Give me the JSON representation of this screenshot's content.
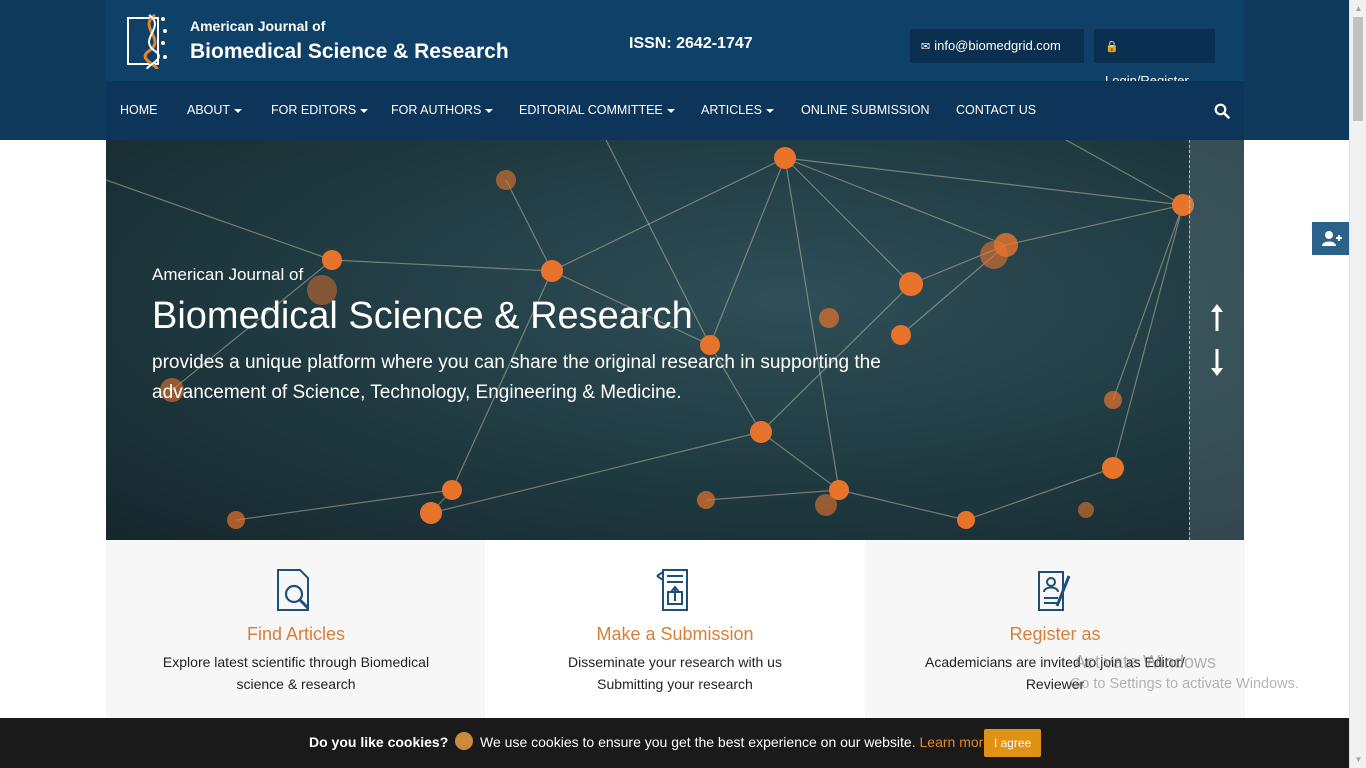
{
  "header": {
    "logo_small": "American Journal of",
    "logo_big": "Biomedical Science & Research",
    "issn": "ISSN: 2642-1747",
    "email": "info@biomedgrid.com",
    "login": "Login/Register"
  },
  "nav": {
    "items": [
      {
        "label": "HOME",
        "caret": false
      },
      {
        "label": "ABOUT",
        "caret": true
      },
      {
        "label": "FOR EDITORS",
        "caret": true
      },
      {
        "label": "FOR AUTHORS",
        "caret": true
      },
      {
        "label": "EDITORIAL COMMITTEE",
        "caret": true
      },
      {
        "label": "ARTICLES",
        "caret": true
      },
      {
        "label": "ONLINE SUBMISSION",
        "caret": false
      },
      {
        "label": "CONTACT US",
        "caret": false
      }
    ]
  },
  "hero": {
    "small": "American Journal of",
    "title": "Biomedical Science & Research",
    "desc": "provides a unique platform where you can share the original research in supporting the advancement of Science, Technology, Engineering & Medicine."
  },
  "features": [
    {
      "title": "Find Articles",
      "desc": "Explore latest scientific through Biomedical science & research",
      "icon": "search-document-icon"
    },
    {
      "title": "Make a Submission",
      "desc": "Disseminate your research with us Submitting your research",
      "icon": "upload-document-icon"
    },
    {
      "title": "Register as",
      "desc": "Academicians are invited to join as Editor/ Reviewer",
      "icon": "register-form-icon"
    }
  ],
  "watermark": {
    "line1": "Activate Windows",
    "line2": "Go to Settings to activate Windows."
  },
  "cookie": {
    "question": "Do you like cookies?",
    "text": "We use cookies to ensure you get the best experience on our website.",
    "learn": "Learn more",
    "agree": "I agree"
  },
  "colors": {
    "header_bg": "#0f4168",
    "nav_bg": "#0d3559",
    "accent": "#d4803a",
    "cookie_button": "#e09217"
  }
}
